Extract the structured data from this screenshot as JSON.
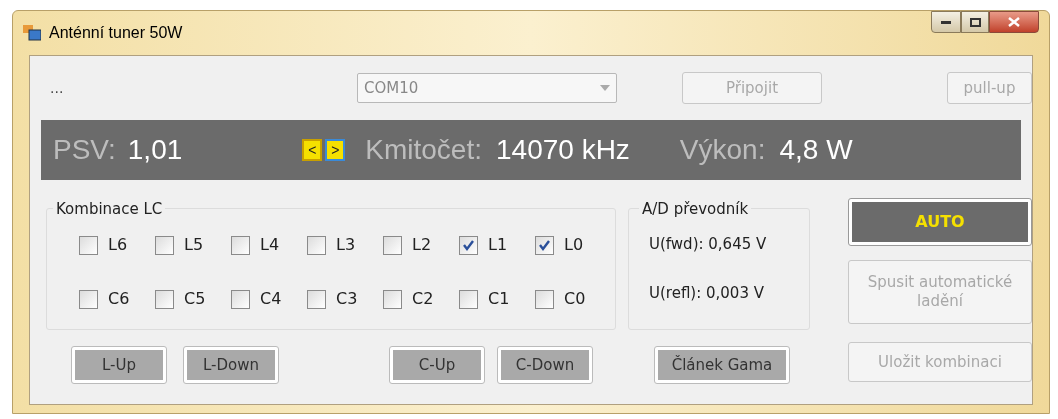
{
  "window": {
    "title": "Anténní tuner 50W"
  },
  "toolbar": {
    "status": "...",
    "port": {
      "value": "COM10"
    },
    "connect": {
      "label": "Připojit",
      "disabled": true
    },
    "pullup": {
      "label": "pull-up",
      "disabled": true
    }
  },
  "readout": {
    "psv_label": "PSV:",
    "psv_value": "1,01",
    "prev": "<",
    "next": ">",
    "freq_label": "Kmitočet:",
    "freq_value": "14070 kHz",
    "power_label": "Výkon:",
    "power_value": "4,8 W"
  },
  "lc_group": {
    "title": "Kombinace LC",
    "rows": [
      [
        {
          "label": "L6",
          "checked": false
        },
        {
          "label": "L5",
          "checked": false
        },
        {
          "label": "L4",
          "checked": false
        },
        {
          "label": "L3",
          "checked": false
        },
        {
          "label": "L2",
          "checked": false
        },
        {
          "label": "L1",
          "checked": true
        },
        {
          "label": "L0",
          "checked": true
        }
      ],
      [
        {
          "label": "C6",
          "checked": false
        },
        {
          "label": "C5",
          "checked": false
        },
        {
          "label": "C4",
          "checked": false
        },
        {
          "label": "C3",
          "checked": false
        },
        {
          "label": "C2",
          "checked": false
        },
        {
          "label": "C1",
          "checked": false
        },
        {
          "label": "C0",
          "checked": false
        }
      ]
    ]
  },
  "ad_group": {
    "title": "A/D převodník",
    "fwd": "U(fwd): 0,645 V",
    "refl": "U(refl): 0,003 V"
  },
  "bottom_buttons": [
    {
      "label": "L-Up"
    },
    {
      "label": "L-Down"
    },
    {
      "label": "C-Up"
    },
    {
      "label": "C-Down"
    },
    {
      "label": "Článek Gama"
    }
  ],
  "side_buttons": [
    {
      "label": "AUTO",
      "kind": "dark",
      "disabled": false
    },
    {
      "label": "Spusit automatické ladění",
      "kind": "plain",
      "disabled": true
    },
    {
      "label": "Uložit kombinaci",
      "kind": "plain",
      "disabled": true
    }
  ]
}
